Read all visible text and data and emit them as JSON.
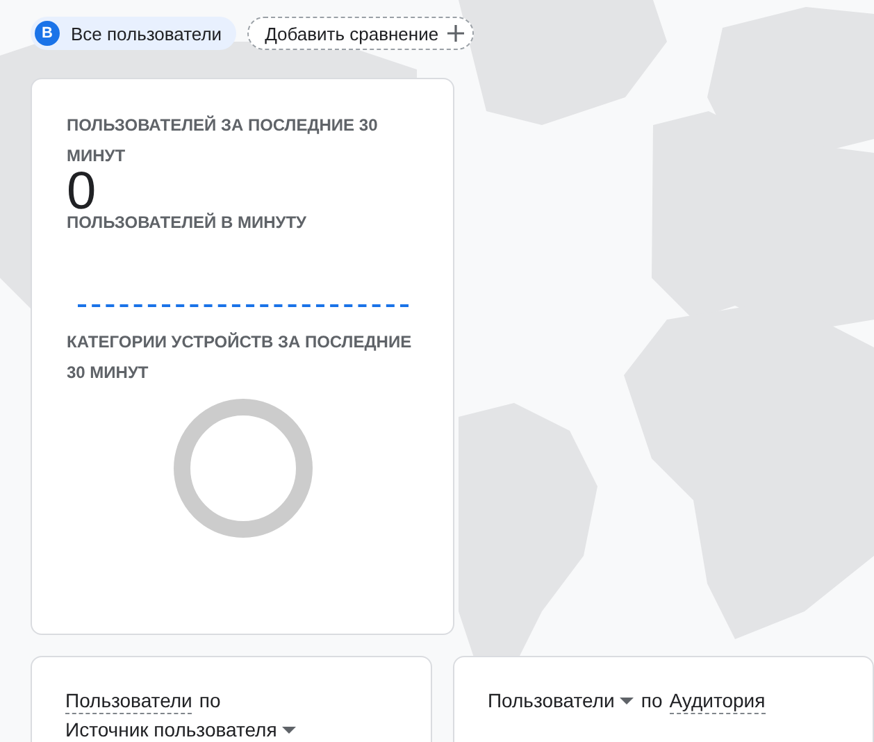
{
  "filter_bar": {
    "segments": [
      {
        "badge": "B",
        "label": "Все пользователи"
      }
    ],
    "add_comparison": "Добавить сравнение"
  },
  "realtime_card": {
    "users_title": "ПОЛЬЗОВАТЕЛЕЙ ЗА ПОСЛЕДНИЕ 30 МИНУТ",
    "users_value": "0",
    "per_minute_title": "ПОЛЬЗОВАТЕЛЕЙ В МИНУТУ",
    "devices_title": "КАТЕГОРИИ УСТРОЙСТВ ЗА ПОСЛЕДНИЕ 30 МИНУТ"
  },
  "cards": [
    {
      "kind": "dimension_menu",
      "metric": "Пользователи",
      "by": "по",
      "dimension": "Источник пользователя"
    },
    {
      "kind": "metric_menu",
      "metric": "Пользователи",
      "by": "по",
      "dimension": "Аудитория"
    }
  ]
}
